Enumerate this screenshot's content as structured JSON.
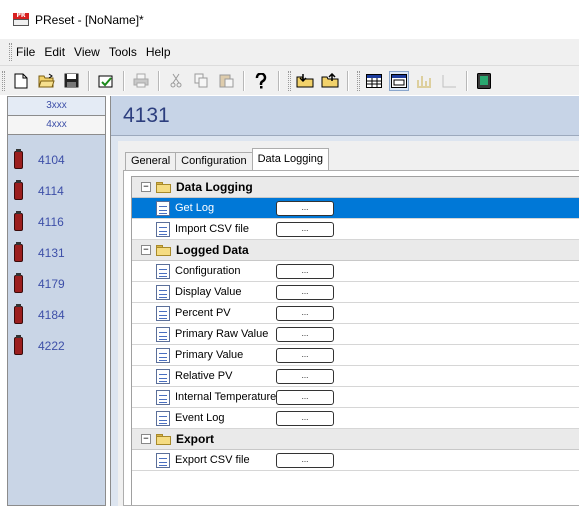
{
  "window": {
    "title": "PReset - [NoName]*",
    "logo_text": "PR"
  },
  "menu": {
    "items": [
      "File",
      "Edit",
      "View",
      "Tools",
      "Help"
    ]
  },
  "toolbar": {
    "buttons": [
      "new-document-icon",
      "open-folder-icon",
      "save-disk-icon",
      "wizard-icon",
      "print-icon",
      "cut-icon",
      "copy-icon",
      "paste-icon",
      "help-icon",
      "read-from-device-icon",
      "write-to-device-icon",
      "table-view-icon",
      "form-view-icon",
      "chart-view-icon",
      "graph-view-icon",
      "monitor-icon"
    ]
  },
  "sidebar": {
    "tabs": [
      "3xxx",
      "4xxx"
    ],
    "active_tab": "4xxx",
    "devices": [
      "4104",
      "4114",
      "4116",
      "4131",
      "4179",
      "4184",
      "4222"
    ]
  },
  "panel": {
    "title": "4131",
    "tabs": [
      "General",
      "Configuration",
      "Data Logging"
    ],
    "active_tab": "Data Logging",
    "groups": [
      {
        "label": "Data Logging",
        "items": [
          "Get Log",
          "Import CSV file"
        ]
      },
      {
        "label": "Logged Data",
        "items": [
          "Configuration",
          "Display Value",
          "Percent PV",
          "Primary Raw Value",
          "Primary Value",
          "Relative PV",
          "Internal Temperature",
          "Event Log"
        ]
      },
      {
        "label": "Export",
        "items": [
          "Export CSV file"
        ]
      }
    ],
    "selected_item": "Get Log",
    "button_label": "...",
    "expander_label": "−"
  },
  "colors": {
    "accent": "#0078d7",
    "sidebar_bg": "#c9d5e6",
    "panel_header_bg": "#c7d4e7",
    "device_text": "#3d4fa8"
  }
}
